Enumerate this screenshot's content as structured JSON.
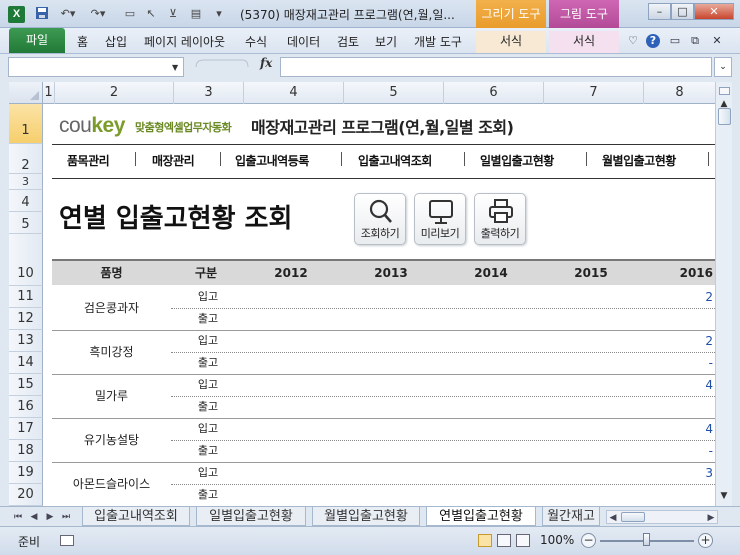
{
  "window": {
    "title": "(5370) 매장재고관리 프로그램(연,월,일...",
    "context_tab_drawing": "그리기 도구",
    "context_tab_picture": "그림 도구",
    "app_logo": "X"
  },
  "ribbon": {
    "tabs": [
      "파일",
      "홈",
      "삽입",
      "페이지 레이아웃",
      "수식",
      "데이터",
      "검토",
      "보기",
      "개발 도구",
      "서식",
      "서식"
    ]
  },
  "formula_bar": {
    "name_box": "",
    "fx_label": "fx",
    "formula": ""
  },
  "columns": [
    "1",
    "2",
    "3",
    "4",
    "5",
    "6",
    "7",
    "8"
  ],
  "rows": [
    "1",
    "2",
    "3",
    "4",
    "5",
    "10",
    "11",
    "12",
    "13",
    "14",
    "15",
    "16",
    "17",
    "18",
    "19",
    "20"
  ],
  "sheet": {
    "brand_name_a": "cou",
    "brand_name_b": "key",
    "brand_tagline": "맞춤형엑셀업무자동화",
    "program_title": "매장재고관리 프로그램(연,월,일별 조회)",
    "nav": [
      "품목관리",
      "매장관리",
      "입출고내역등록",
      "입출고내역조회",
      "일별입출고현황",
      "월별입출고현황"
    ],
    "page_title": "연별 입출고현황 조회",
    "buttons": [
      {
        "label": "조회하기",
        "icon": "search-icon"
      },
      {
        "label": "미리보기",
        "icon": "monitor-icon"
      },
      {
        "label": "출력하기",
        "icon": "printer-icon"
      }
    ],
    "table_headers": [
      "품명",
      "구분",
      "2012",
      "2013",
      "2014",
      "2015",
      "2016"
    ],
    "products": [
      {
        "name": "검은콩과자",
        "in_label": "입고",
        "out_label": "출고",
        "in_2016": "2",
        "out_2016": ""
      },
      {
        "name": "흑미강정",
        "in_label": "입고",
        "out_label": "출고",
        "in_2016": "2",
        "out_2016": "-"
      },
      {
        "name": "밀가루",
        "in_label": "입고",
        "out_label": "출고",
        "in_2016": "4",
        "out_2016": ""
      },
      {
        "name": "유기농설탕",
        "in_label": "입고",
        "out_label": "출고",
        "in_2016": "4",
        "out_2016": "-"
      },
      {
        "name": "아몬드슬라이스",
        "in_label": "입고",
        "out_label": "출고",
        "in_2016": "3",
        "out_2016": ""
      }
    ]
  },
  "sheet_tabs": [
    "입출고내역조회",
    "일별입출고현황",
    "월별입출고현황",
    "연별입출고현황",
    "월간재고"
  ],
  "active_sheet_tab": "연별입출고현황",
  "status": {
    "ready": "준비",
    "zoom": "100%",
    "zoom_level": 1.0
  },
  "colors": {
    "file_tab": "#217a37",
    "drawing_tools": "#e99c2b",
    "picture_tools": "#b34a98",
    "value_text": "#1f4fa8",
    "brand_green": "#7b9b2a"
  }
}
